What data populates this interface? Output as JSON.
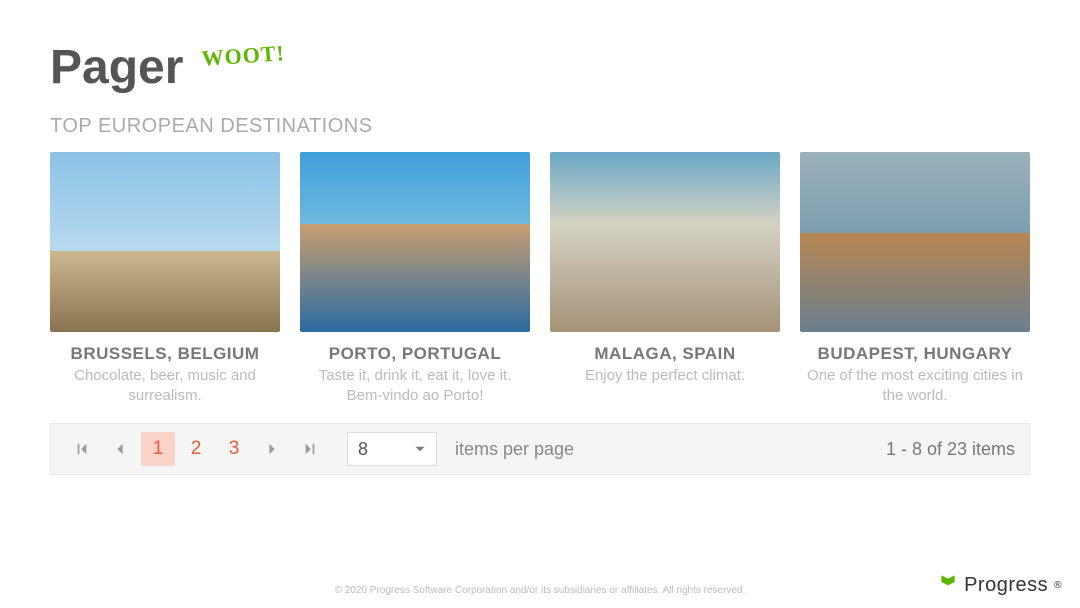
{
  "header": {
    "title": "Pager",
    "woot": "WOOT!"
  },
  "section_title": "TOP EUROPEAN DESTINATIONS",
  "cards": [
    {
      "title": "BRUSSELS, BELGIUM",
      "desc": "Chocolate, beer, music and surrealism."
    },
    {
      "title": "PORTO, PORTUGAL",
      "desc": "Taste it, drink it, eat it, love it. Bem-vindo ao Porto!"
    },
    {
      "title": "MALAGA, SPAIN",
      "desc": "Enjoy the perfect climat."
    },
    {
      "title": "BUDAPEST, HUNGARY",
      "desc": "One of the most exciting cities in the world."
    }
  ],
  "pager": {
    "pages": [
      "1",
      "2",
      "3"
    ],
    "active_page": "1",
    "page_size": "8",
    "items_per_page_label": "items per page",
    "info": "1 - 8 of 23 items"
  },
  "footer": "© 2020 Progress Software Corporation and/or its subsidiaries or affiliates. All rights reserved.",
  "brand": "Progress"
}
